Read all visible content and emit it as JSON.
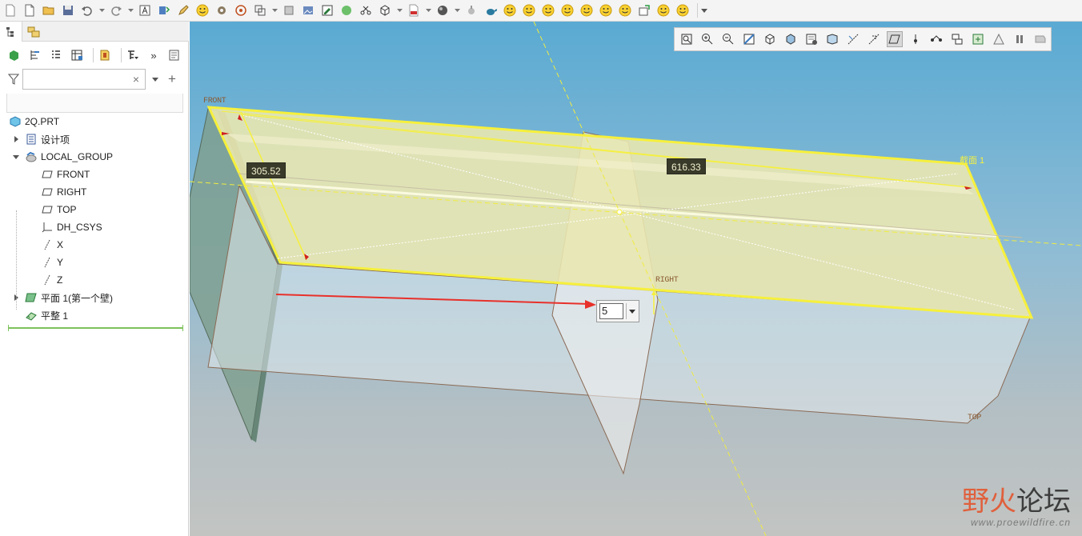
{
  "search": {
    "placeholder": "",
    "value": "",
    "clear": "×"
  },
  "filter_add": "+",
  "view_toolbar_more": "»",
  "tree": {
    "root": "2Q.PRT",
    "design_items": "设计项",
    "local_group": "LOCAL_GROUP",
    "front": "FRONT",
    "right": "RIGHT",
    "top": "TOP",
    "csys": "DH_CSYS",
    "axis_x": "X",
    "axis_y": "Y",
    "axis_z": "Z",
    "plane_wall": "平面 1(第一个壁)",
    "flatten": "平整 1"
  },
  "viewport": {
    "dim_left": "305.52",
    "dim_right": "616.33",
    "tag_front": "FRONT",
    "tag_right": "RIGHT",
    "tag_top": "TOP",
    "section_label": "截面 1",
    "depth_value": "5"
  },
  "watermark": {
    "part1": "野",
    "part2": "火",
    "part3": "论坛",
    "url": "www.proewildfire.cn"
  },
  "colors": {
    "highlight": "#f6f03c",
    "sketch_fill": "#e6e3b0",
    "arrow": "#e8302a",
    "bg_top": "#5aaad3",
    "bg_bottom": "#c2c4c2"
  }
}
